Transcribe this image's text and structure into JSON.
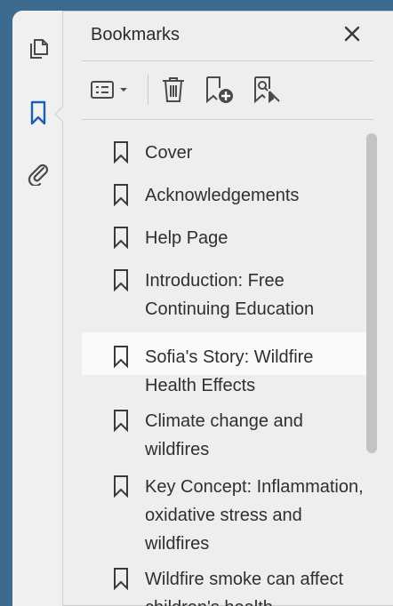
{
  "panel": {
    "title": "Bookmarks"
  },
  "toolbar": {
    "options_icon": "list-options-icon",
    "delete_icon": "trash-icon",
    "new_bookmark_icon": "new-bookmark-icon",
    "bookmark_search_icon": "bookmark-search-icon"
  },
  "rail": {
    "items": [
      "pages-icon",
      "bookmarks-icon",
      "attachments-icon"
    ]
  },
  "bookmarks": [
    {
      "label": "Cover"
    },
    {
      "label": "Acknowledgements"
    },
    {
      "label": "Help Page"
    },
    {
      "label": "Introduction: Free Continuing Education"
    },
    {
      "label": "Sofia's Story: Wildfire Health Effects",
      "selected": true
    },
    {
      "label": "Climate change and wildfires"
    },
    {
      "label": "Key Concept: Inflammation, oxidative stress and wildfires"
    },
    {
      "label": "Wildfire smoke can affect children's health"
    }
  ],
  "colors": {
    "background": "#3d6a8f",
    "accent": "#1a5fb4",
    "panel": "#eeeeee"
  }
}
